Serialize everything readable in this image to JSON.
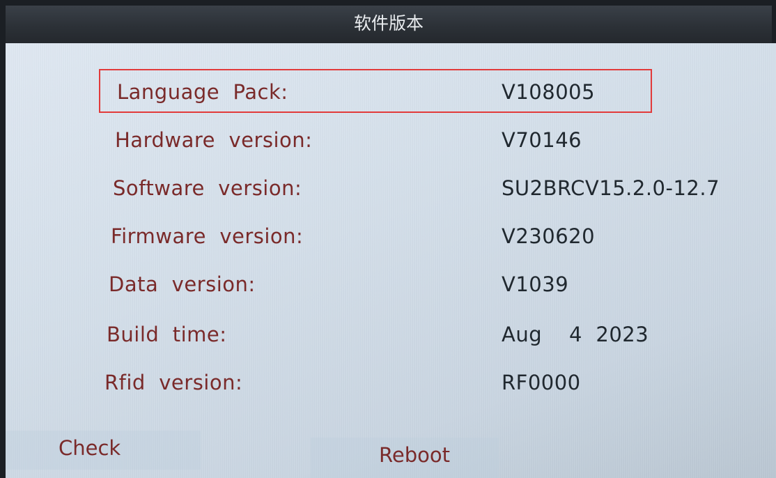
{
  "header": {
    "title": "软件版本"
  },
  "rows": [
    {
      "label": "Language  Pack:",
      "value": "V108005"
    },
    {
      "label": "Hardware  version:",
      "value": "V70146"
    },
    {
      "label": "Software  version:",
      "value": "SU2BRCV15.2.0-12.7"
    },
    {
      "label": "Firmware  version:",
      "value": "V230620"
    },
    {
      "label": "Data  version:",
      "value": "V1039"
    },
    {
      "label": "Build  time:",
      "value": "Aug    4  2023"
    },
    {
      "label": "Rfid  version:",
      "value": "RF0000"
    }
  ],
  "buttons": {
    "check": "Check",
    "reboot": "Reboot"
  },
  "colors": {
    "highlight": "#e23a3a",
    "label": "#7a2a2a",
    "value": "#20282f",
    "title_bar": "#2c3137"
  }
}
